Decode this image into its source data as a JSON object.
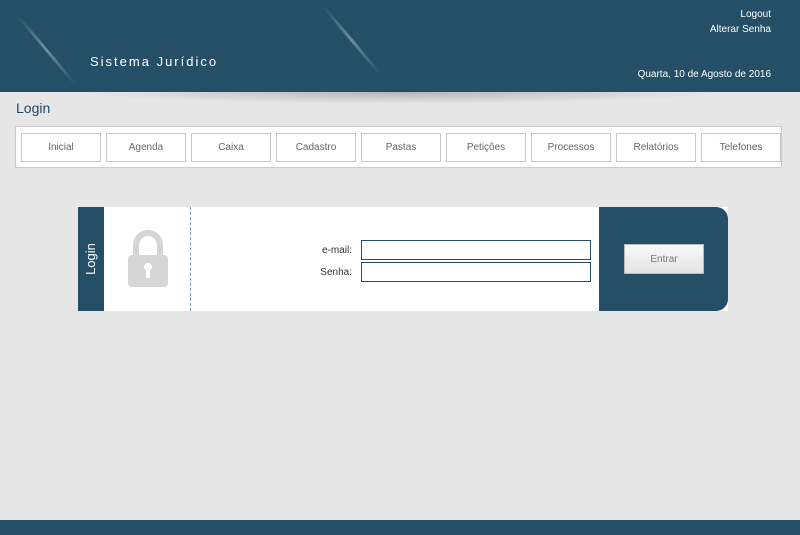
{
  "header": {
    "brand": "Sistema Jurídico",
    "logout_label": "Logout",
    "change_password_label": "Alterar Senha",
    "date": "Quarta, 10 de Agosto de 2016"
  },
  "page": {
    "title": "Login"
  },
  "nav": {
    "items": [
      {
        "label": "Inicial"
      },
      {
        "label": "Agenda"
      },
      {
        "label": "Caixa"
      },
      {
        "label": "Cadastro"
      },
      {
        "label": "Pastas"
      },
      {
        "label": "Petições"
      },
      {
        "label": "Processos"
      },
      {
        "label": "Relatórios"
      },
      {
        "label": "Telefones"
      }
    ]
  },
  "login": {
    "tab_label": "Login",
    "email_label": "e-mail:",
    "email_value": "",
    "password_label": "Senha:",
    "password_value": "",
    "submit_label": "Entrar"
  },
  "icons": {
    "lock": "lock-icon"
  },
  "colors": {
    "primary": "#244f66",
    "background": "#e6e6e6"
  }
}
